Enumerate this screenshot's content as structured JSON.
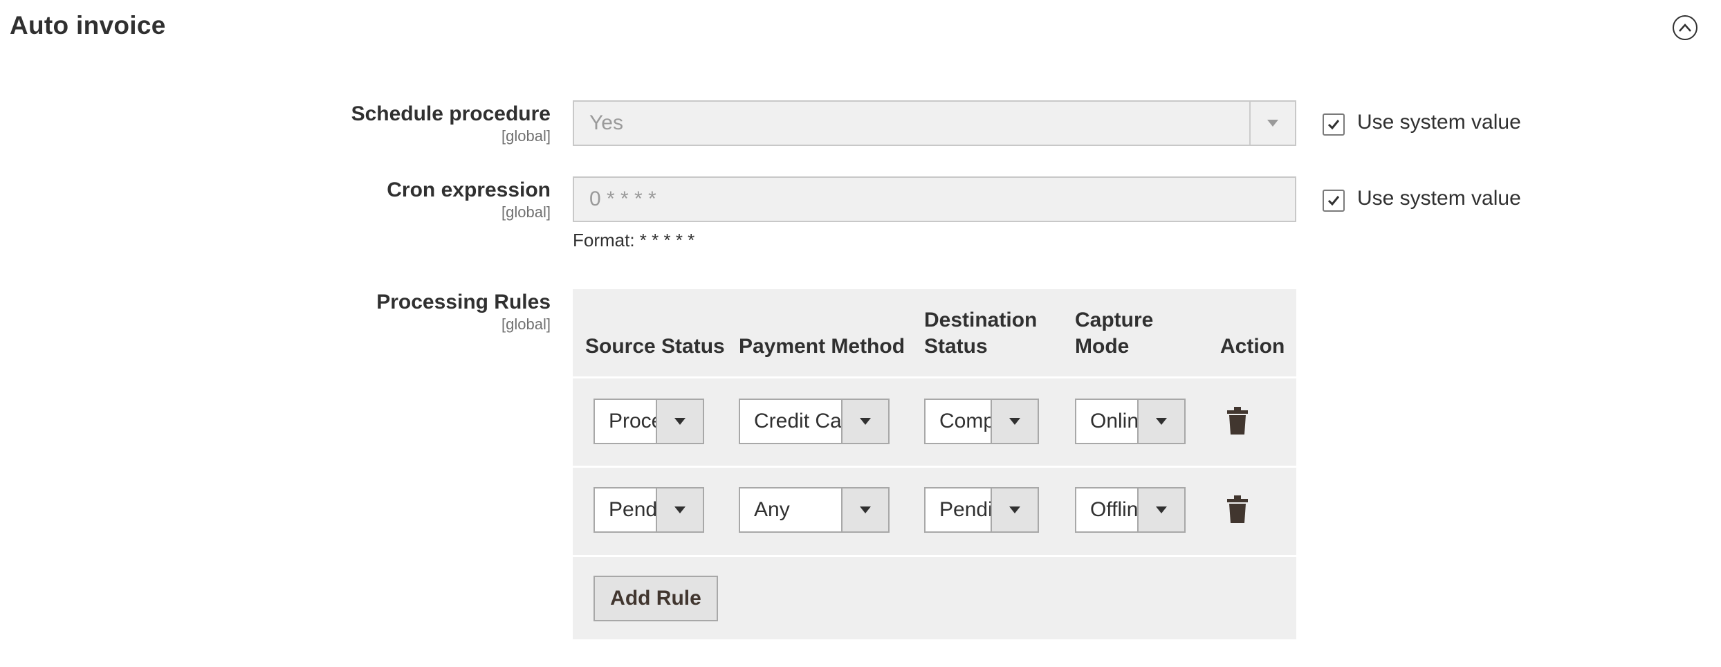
{
  "section": {
    "title": "Auto invoice"
  },
  "fields": {
    "schedule": {
      "label": "Schedule procedure",
      "scope": "[global]",
      "value": "Yes",
      "use_system_label": "Use system value"
    },
    "cron": {
      "label": "Cron expression",
      "scope": "[global]",
      "value": "0 * * * *",
      "note": "Format: * * * * *",
      "use_system_label": "Use system value"
    },
    "rules": {
      "label": "Processing Rules",
      "scope": "[global]"
    }
  },
  "rules_table": {
    "headers": {
      "source": "Source Status",
      "payment": "Payment Method",
      "destination_line1": "Destination",
      "destination_line2": "Status",
      "capture_line1": "Capture",
      "capture_line2": "Mode",
      "action": "Action"
    },
    "rows": [
      {
        "source": "Processing",
        "payment": "Credit Card",
        "destination": "Complete",
        "capture": "Online"
      },
      {
        "source": "Pending",
        "payment": "Any",
        "destination": "Pending",
        "capture": "Offline"
      }
    ],
    "add_label": "Add Rule"
  },
  "icons": {
    "collapse": "chevron-up-circle-icon",
    "delete": "trash-icon",
    "check": "checkmark-icon"
  }
}
